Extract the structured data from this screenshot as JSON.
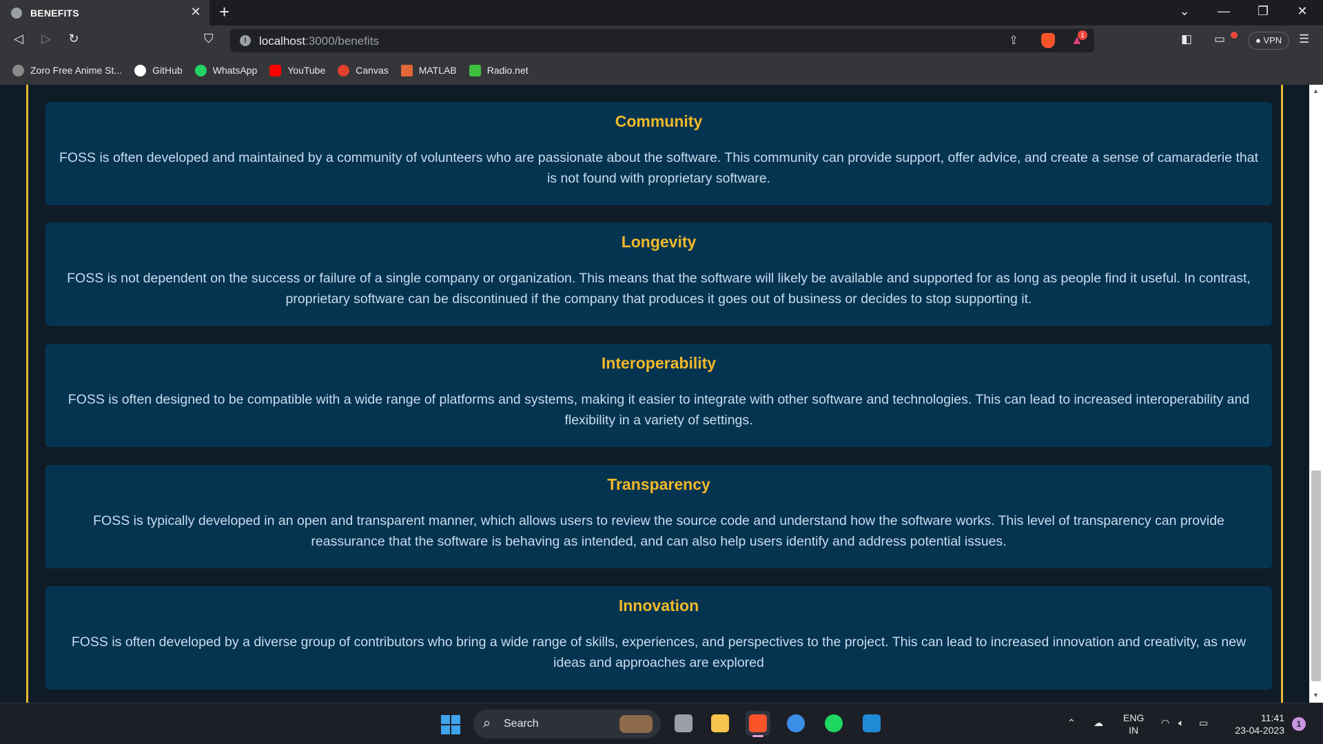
{
  "browser": {
    "tab_title": "BENEFITS",
    "url_host": "localhost",
    "url_path": ":3000/benefits",
    "vpn_label": "VPN",
    "rewards_badge": "1"
  },
  "bookmarks": [
    {
      "label": "Zoro Free Anime St...",
      "icon": "zoro-icon",
      "color": "#8a8a8a"
    },
    {
      "label": "GitHub",
      "icon": "github-icon",
      "color": "#ffffff"
    },
    {
      "label": "WhatsApp",
      "icon": "whatsapp-icon",
      "color": "#25d366"
    },
    {
      "label": "YouTube",
      "icon": "youtube-icon",
      "color": "#ff0000"
    },
    {
      "label": "Canvas",
      "icon": "canvas-icon",
      "color": "#e13f2b"
    },
    {
      "label": "MATLAB",
      "icon": "matlab-icon",
      "color": "#e16737"
    },
    {
      "label": "Radio.net",
      "icon": "radio-icon",
      "color": "#3fbf3f"
    }
  ],
  "page": {
    "accent": "#e9b92f",
    "cards": [
      {
        "title": "Community",
        "text": "FOSS is often developed and maintained by a community of volunteers who are passionate about the software. This community can provide support, offer advice, and create a sense of camaraderie that is not found with proprietary software."
      },
      {
        "title": "Longevity",
        "text": "FOSS is not dependent on the success or failure of a single company or organization. This means that the software will likely be available and supported for as long as people find it useful. In contrast, proprietary software can be discontinued if the company that produces it goes out of business or decides to stop supporting it."
      },
      {
        "title": "Interoperability",
        "text": "FOSS is often designed to be compatible with a wide range of platforms and systems, making it easier to integrate with other software and technologies. This can lead to increased interoperability and flexibility in a variety of settings."
      },
      {
        "title": "Transparency",
        "text": "FOSS is typically developed in an open and transparent manner, which allows users to review the source code and understand how the software works. This level of transparency can provide reassurance that the software is behaving as intended, and can also help users identify and address potential issues."
      },
      {
        "title": "Innovation",
        "text": "FOSS is often developed by a diverse group of contributors who bring a wide range of skills, experiences, and perspectives to the project. This can lead to increased innovation and creativity, as new ideas and approaches are explored"
      }
    ]
  },
  "taskbar": {
    "search_label": "Search",
    "lang_line1": "ENG",
    "lang_line2": "IN",
    "time": "11:41",
    "date": "23-04-2023",
    "notification_count": "1"
  }
}
